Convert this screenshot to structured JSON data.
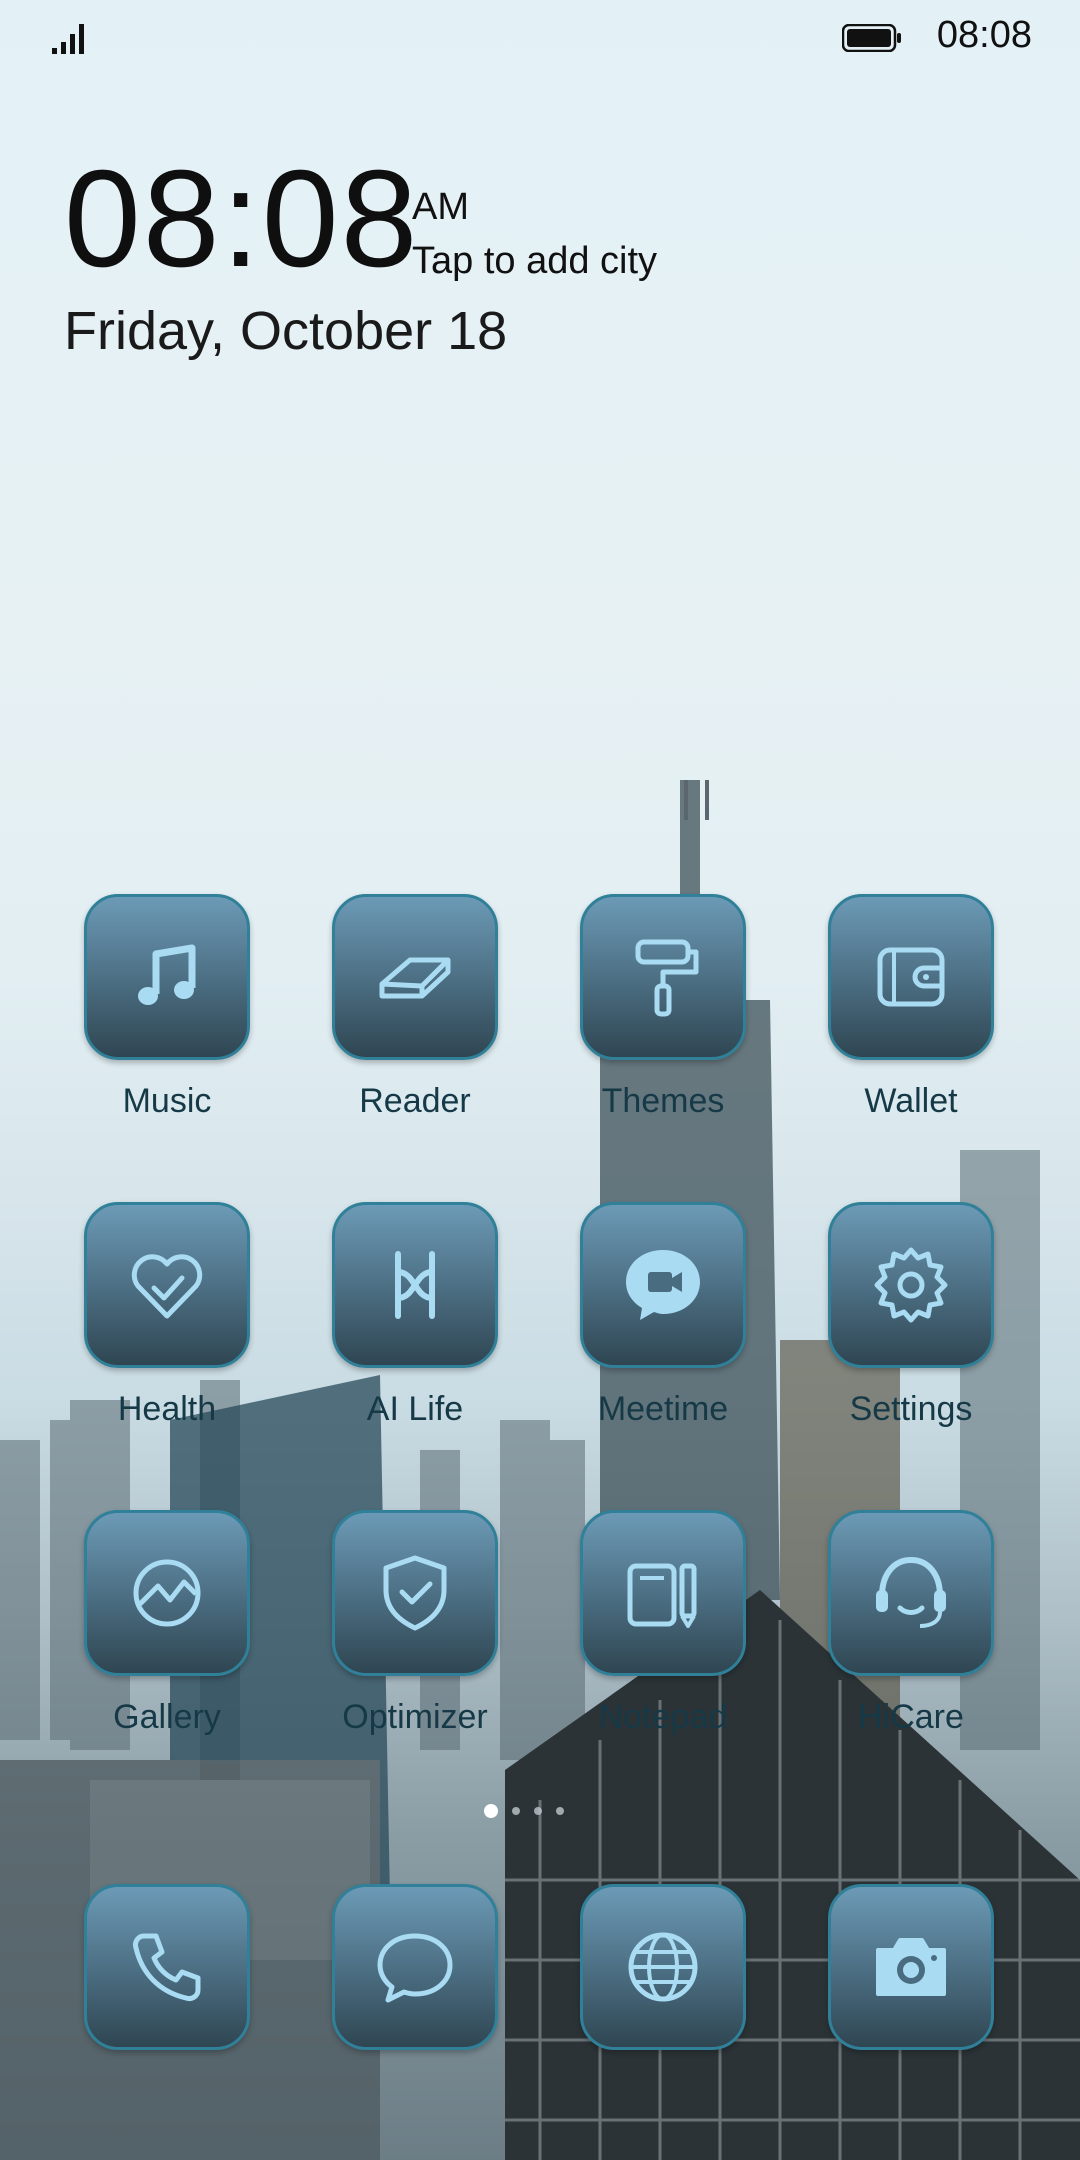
{
  "status_bar": {
    "time": "08:08",
    "signal_icon": "signal-icon",
    "battery_icon": "battery-icon"
  },
  "clock_widget": {
    "time": "08:08",
    "ampm": "AM",
    "city_prompt": "Tap to add city",
    "date": "Friday, October 18"
  },
  "apps": [
    {
      "label": "Music",
      "icon": "music-note-icon"
    },
    {
      "label": "Reader",
      "icon": "eraser-book-icon"
    },
    {
      "label": "Themes",
      "icon": "paint-roller-icon"
    },
    {
      "label": "Wallet",
      "icon": "wallet-icon"
    },
    {
      "label": "Health",
      "icon": "heart-check-icon"
    },
    {
      "label": "AI Life",
      "icon": "ai-life-icon"
    },
    {
      "label": "Meetime",
      "icon": "video-chat-icon"
    },
    {
      "label": "Settings",
      "icon": "gear-icon"
    },
    {
      "label": "Gallery",
      "icon": "gallery-icon"
    },
    {
      "label": "Optimizer",
      "icon": "shield-check-icon"
    },
    {
      "label": "Notepad",
      "icon": "notepad-icon"
    },
    {
      "label": "HiCare",
      "icon": "headset-icon"
    }
  ],
  "dock": [
    {
      "icon": "phone-icon"
    },
    {
      "icon": "chat-bubble-icon"
    },
    {
      "icon": "globe-icon"
    },
    {
      "icon": "camera-icon"
    }
  ],
  "page_indicator": {
    "pages": 4,
    "active": 1
  },
  "colors": {
    "tile_top": "#6c9ab6",
    "tile_bottom": "#2f4652",
    "tile_border": "#2f8098",
    "icon_stroke": "#a9dbf2",
    "label": "#163947"
  }
}
